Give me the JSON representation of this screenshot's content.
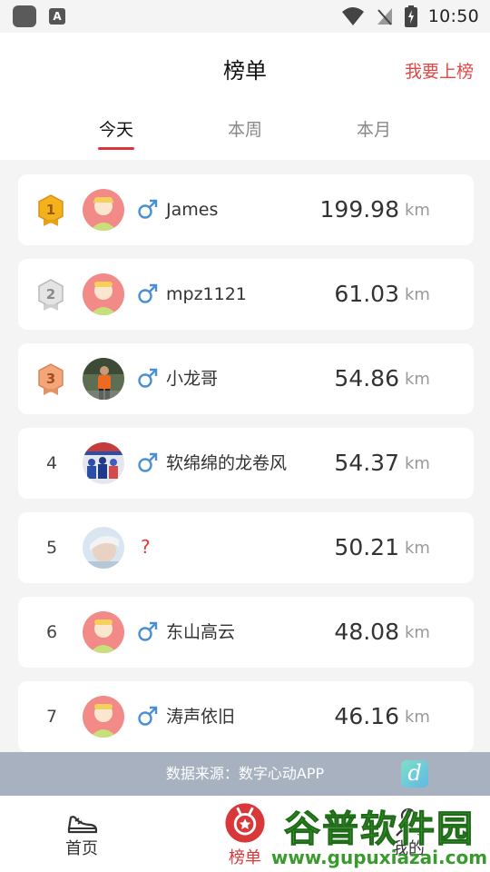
{
  "status_bar": {
    "time": "10:50",
    "a_badge": "A"
  },
  "header": {
    "title": "榜单",
    "join_link": "我要上榜",
    "tabs": [
      {
        "label": "今天",
        "active": true
      },
      {
        "label": "本周",
        "active": false
      },
      {
        "label": "本月",
        "active": false
      }
    ]
  },
  "leaderboard": {
    "unit": "km",
    "entries": [
      {
        "rank": "1",
        "medal": "gold",
        "name": "James",
        "gender": "male",
        "distance": "199.98",
        "avatar": "default"
      },
      {
        "rank": "2",
        "medal": "silver",
        "name": "mpz1121",
        "gender": "male",
        "distance": "61.03",
        "avatar": "default"
      },
      {
        "rank": "3",
        "medal": "bronze",
        "name": "小龙哥",
        "gender": "male",
        "distance": "54.86",
        "avatar": "photo-runner"
      },
      {
        "rank": "4",
        "medal": "",
        "name": "软绵绵的龙卷风",
        "gender": "male",
        "distance": "54.37",
        "avatar": "photo-crowd"
      },
      {
        "rank": "5",
        "medal": "",
        "name": "",
        "gender": "unknown",
        "gender_mark": "?",
        "distance": "50.21",
        "avatar": "photo-face"
      },
      {
        "rank": "6",
        "medal": "",
        "name": "东山高云",
        "gender": "male",
        "distance": "48.08",
        "avatar": "default"
      },
      {
        "rank": "7",
        "medal": "",
        "name": "涛声依旧",
        "gender": "male",
        "distance": "46.16",
        "avatar": "default"
      }
    ]
  },
  "banner": {
    "text": "数据来源：数字心动APP",
    "logo_letter": "d"
  },
  "bottom_nav": {
    "items": [
      {
        "label": "首页",
        "icon": "sneaker-icon",
        "active": false
      },
      {
        "label": "榜单",
        "icon": "medal-icon",
        "active": true
      },
      {
        "label": "我的",
        "icon": "user-icon",
        "active": false
      }
    ]
  },
  "watermark": {
    "title": "谷普软件园",
    "url": "www.gupuxiazai.com"
  },
  "colors": {
    "accent": "#d9383a",
    "background": "#f4f4f4",
    "banner": "#a7b1c0",
    "gender_male": "#4a8fd6",
    "avatar_default": "#f28b88"
  }
}
